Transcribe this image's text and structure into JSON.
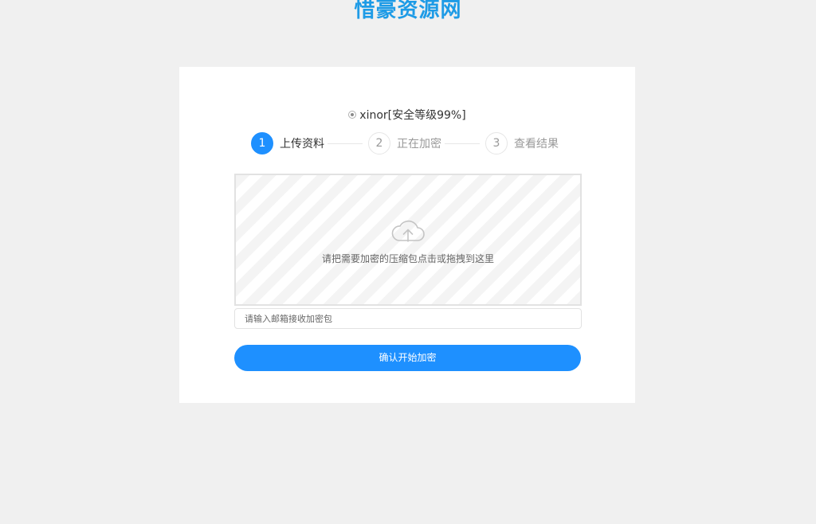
{
  "header": {
    "logo_text": "惜豪资源网"
  },
  "option": {
    "label": "xinor[安全等级99%]",
    "selected": true
  },
  "steps": [
    {
      "number": "1",
      "label": "上传资料",
      "active": true
    },
    {
      "number": "2",
      "label": "正在加密",
      "active": false
    },
    {
      "number": "3",
      "label": "查看结果",
      "active": false
    }
  ],
  "upload": {
    "icon": "cloud-upload-icon",
    "hint": "请把需要加密的压缩包点击或拖拽到这里"
  },
  "email": {
    "value": "",
    "placeholder": "请输入邮箱接收加密包"
  },
  "submit": {
    "label": "确认开始加密"
  },
  "colors": {
    "accent": "#1e90ff",
    "background": "#f0f0f0",
    "logo": "#1e9be6"
  }
}
